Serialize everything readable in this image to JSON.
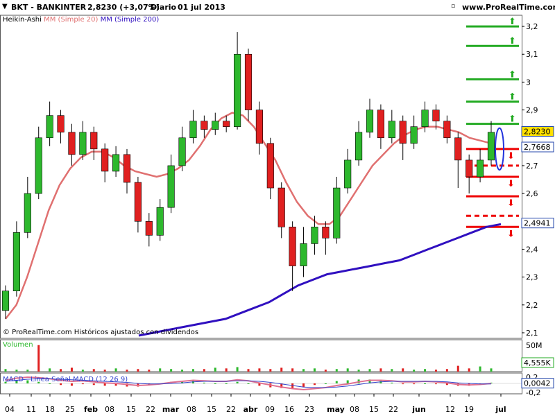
{
  "header": {
    "symbol": "BKT - BANKINTER",
    "price": "2,8230 (+3,07%)",
    "period": "Diario",
    "date": "01 jul 2013",
    "site": "www.ProRealTime.com",
    "win_icon": "minimize-maximize-close-icons"
  },
  "legend": {
    "main": "Heikin-Ashi",
    "ma20": "MM (Simple 20)",
    "ma200": "MM (Simple 200)",
    "ma20_color": "#e07070",
    "ma200_color": "#3010c0"
  },
  "footer_note": "© ProRealTime.com Históricos ajustados con dividendos",
  "volume_panel": {
    "title": "Volumen",
    "axis_label": "50M",
    "value_tag": "4,555K"
  },
  "macd_panel": {
    "title": "MACD - Línea Señal MACD (12 26 9)",
    "axis_top": "0,2",
    "axis_bottom": "-0,2",
    "value_tag": "0,0042"
  },
  "colors": {
    "up": "#2db82d",
    "down": "#e02020",
    "level_up": "#22aa22",
    "level_down": "#ee0000",
    "ellipse": "#2233dd"
  },
  "chart_data": {
    "type": "candlestick",
    "title": "BKT - BANKINTER",
    "ylim": [
      2.08,
      3.24
    ],
    "y_ticks": [
      "3,2",
      "3,1",
      "3",
      "2,9",
      "2,7",
      "2,6",
      "2,4",
      "2,3",
      "2,2",
      "2,1"
    ],
    "y_tick_values": [
      3.2,
      3.1,
      3.0,
      2.9,
      2.7,
      2.6,
      2.4,
      2.3,
      2.2,
      2.1
    ],
    "price_tags": [
      {
        "label": "2,8230",
        "value": 2.823,
        "style": "yellow"
      },
      {
        "label": "2,7668",
        "value": 2.767,
        "style": "white"
      },
      {
        "label": "2,4941",
        "value": 2.494,
        "style": "white"
      }
    ],
    "x_labels": [
      "04",
      "11",
      "18",
      "25",
      "feb",
      "08",
      "15",
      "22",
      "mar",
      "08",
      "15",
      "22",
      "abr",
      "09",
      "16",
      "23",
      "may",
      "08",
      "15",
      "22",
      "jun",
      "12",
      "19",
      "jul"
    ],
    "green_levels": [
      3.2,
      3.13,
      3.01,
      2.93,
      2.85
    ],
    "red_levels_solid": [
      2.76,
      2.66,
      2.59,
      2.48
    ],
    "red_levels_dashed": [
      2.7,
      2.52
    ],
    "ma20": [
      2.15,
      2.2,
      2.3,
      2.42,
      2.54,
      2.63,
      2.69,
      2.73,
      2.75,
      2.75,
      2.73,
      2.7,
      2.68,
      2.67,
      2.66,
      2.67,
      2.69,
      2.72,
      2.77,
      2.83,
      2.87,
      2.89,
      2.88,
      2.84,
      2.78,
      2.72,
      2.64,
      2.57,
      2.52,
      2.49,
      2.49,
      2.52,
      2.58,
      2.64,
      2.7,
      2.74,
      2.78,
      2.81,
      2.83,
      2.84,
      2.84,
      2.83,
      2.82,
      2.8,
      2.79,
      2.78
    ],
    "ma200": [
      2.09,
      2.1,
      2.11,
      2.12,
      2.13,
      2.14,
      2.15,
      2.17,
      2.19,
      2.21,
      2.24,
      2.27,
      2.29,
      2.31,
      2.32,
      2.33,
      2.34,
      2.35,
      2.36,
      2.38,
      2.4,
      2.42,
      2.44,
      2.46,
      2.48,
      2.49
    ],
    "candles": [
      {
        "o": 2.18,
        "c": 2.25,
        "h": 2.27,
        "l": 2.15
      },
      {
        "o": 2.25,
        "c": 2.46,
        "h": 2.5,
        "l": 2.23
      },
      {
        "o": 2.46,
        "c": 2.6,
        "h": 2.66,
        "l": 2.44
      },
      {
        "o": 2.6,
        "c": 2.8,
        "h": 2.84,
        "l": 2.58
      },
      {
        "o": 2.8,
        "c": 2.88,
        "h": 2.93,
        "l": 2.77
      },
      {
        "o": 2.88,
        "c": 2.82,
        "h": 2.9,
        "l": 2.78
      },
      {
        "o": 2.82,
        "c": 2.74,
        "h": 2.85,
        "l": 2.7
      },
      {
        "o": 2.74,
        "c": 2.82,
        "h": 2.86,
        "l": 2.72
      },
      {
        "o": 2.82,
        "c": 2.76,
        "h": 2.84,
        "l": 2.72
      },
      {
        "o": 2.76,
        "c": 2.68,
        "h": 2.78,
        "l": 2.64
      },
      {
        "o": 2.68,
        "c": 2.74,
        "h": 2.77,
        "l": 2.66
      },
      {
        "o": 2.74,
        "c": 2.64,
        "h": 2.76,
        "l": 2.6
      },
      {
        "o": 2.64,
        "c": 2.5,
        "h": 2.66,
        "l": 2.46
      },
      {
        "o": 2.5,
        "c": 2.45,
        "h": 2.53,
        "l": 2.41
      },
      {
        "o": 2.45,
        "c": 2.55,
        "h": 2.58,
        "l": 2.43
      },
      {
        "o": 2.55,
        "c": 2.7,
        "h": 2.74,
        "l": 2.53
      },
      {
        "o": 2.7,
        "c": 2.8,
        "h": 2.84,
        "l": 2.68
      },
      {
        "o": 2.8,
        "c": 2.86,
        "h": 2.9,
        "l": 2.78
      },
      {
        "o": 2.86,
        "c": 2.83,
        "h": 2.88,
        "l": 2.8
      },
      {
        "o": 2.83,
        "c": 2.86,
        "h": 2.89,
        "l": 2.81
      },
      {
        "o": 2.86,
        "c": 2.84,
        "h": 2.88,
        "l": 2.82
      },
      {
        "o": 2.84,
        "c": 3.1,
        "h": 3.18,
        "l": 2.83
      },
      {
        "o": 3.1,
        "c": 2.9,
        "h": 3.12,
        "l": 2.86
      },
      {
        "o": 2.9,
        "c": 2.78,
        "h": 2.93,
        "l": 2.74
      },
      {
        "o": 2.78,
        "c": 2.62,
        "h": 2.8,
        "l": 2.58
      },
      {
        "o": 2.62,
        "c": 2.48,
        "h": 2.64,
        "l": 2.44
      },
      {
        "o": 2.48,
        "c": 2.34,
        "h": 2.5,
        "l": 2.25
      },
      {
        "o": 2.34,
        "c": 2.42,
        "h": 2.48,
        "l": 2.3
      },
      {
        "o": 2.42,
        "c": 2.48,
        "h": 2.52,
        "l": 2.38
      },
      {
        "o": 2.48,
        "c": 2.44,
        "h": 2.5,
        "l": 2.38
      },
      {
        "o": 2.44,
        "c": 2.62,
        "h": 2.66,
        "l": 2.42
      },
      {
        "o": 2.62,
        "c": 2.72,
        "h": 2.76,
        "l": 2.6
      },
      {
        "o": 2.72,
        "c": 2.82,
        "h": 2.86,
        "l": 2.7
      },
      {
        "o": 2.82,
        "c": 2.9,
        "h": 2.94,
        "l": 2.8
      },
      {
        "o": 2.9,
        "c": 2.8,
        "h": 2.92,
        "l": 2.76
      },
      {
        "o": 2.8,
        "c": 2.86,
        "h": 2.9,
        "l": 2.78
      },
      {
        "o": 2.86,
        "c": 2.78,
        "h": 2.88,
        "l": 2.72
      },
      {
        "o": 2.78,
        "c": 2.84,
        "h": 2.88,
        "l": 2.76
      },
      {
        "o": 2.84,
        "c": 2.9,
        "h": 2.93,
        "l": 2.82
      },
      {
        "o": 2.9,
        "c": 2.86,
        "h": 2.92,
        "l": 2.83
      },
      {
        "o": 2.86,
        "c": 2.8,
        "h": 2.88,
        "l": 2.78
      },
      {
        "o": 2.8,
        "c": 2.72,
        "h": 2.82,
        "l": 2.62
      },
      {
        "o": 2.72,
        "c": 2.66,
        "h": 2.74,
        "l": 2.6
      },
      {
        "o": 2.66,
        "c": 2.72,
        "h": 2.76,
        "l": 2.64
      },
      {
        "o": 2.72,
        "c": 2.82,
        "h": 2.86,
        "l": 2.7
      }
    ],
    "volume": [
      4,
      3,
      3,
      41,
      5,
      4,
      6,
      3,
      4,
      3,
      5,
      3,
      4,
      3,
      5,
      4,
      3,
      4,
      4,
      6,
      5,
      7,
      4,
      5,
      4,
      6,
      5,
      4,
      5,
      3,
      4,
      5,
      3,
      4,
      5,
      4,
      5,
      3,
      4,
      3,
      4,
      9,
      5,
      8,
      5
    ],
    "macd": [
      0.06,
      0.1,
      0.12,
      0.11,
      0.09,
      0.06,
      0.04,
      0.05,
      0.03,
      0.01,
      0.0,
      -0.02,
      -0.04,
      -0.03,
      -0.01,
      0.02,
      0.04,
      0.06,
      0.05,
      0.04,
      0.04,
      0.07,
      0.05,
      0.01,
      -0.03,
      -0.07,
      -0.1,
      -0.12,
      -0.1,
      -0.08,
      -0.04,
      -0.01,
      0.03,
      0.06,
      0.06,
      0.05,
      0.03,
      0.03,
      0.04,
      0.03,
      0.01,
      -0.02,
      -0.03,
      -0.02,
      0.0
    ],
    "macd_signal": [
      0.04,
      0.06,
      0.08,
      0.09,
      0.09,
      0.08,
      0.07,
      0.06,
      0.05,
      0.04,
      0.03,
      0.02,
      0.0,
      -0.01,
      -0.01,
      0.0,
      0.01,
      0.03,
      0.04,
      0.04,
      0.04,
      0.05,
      0.05,
      0.04,
      0.02,
      -0.01,
      -0.04,
      -0.07,
      -0.08,
      -0.08,
      -0.07,
      -0.05,
      -0.02,
      0.01,
      0.03,
      0.04,
      0.04,
      0.04,
      0.04,
      0.04,
      0.03,
      0.01,
      0.0,
      -0.01,
      -0.01
    ]
  }
}
